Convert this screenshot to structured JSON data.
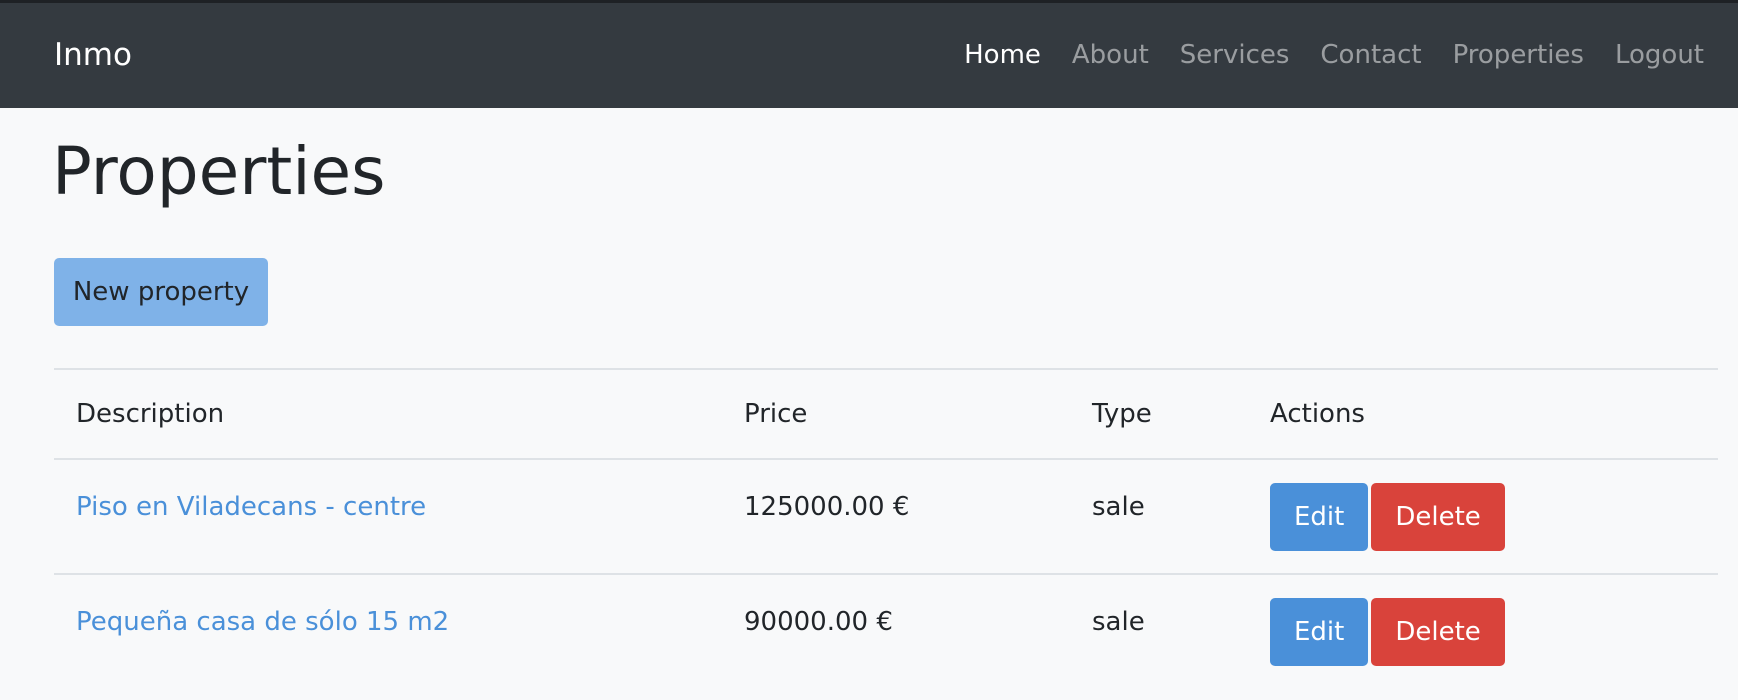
{
  "navbar": {
    "brand": "Inmo",
    "links": [
      {
        "label": "Home",
        "active": true
      },
      {
        "label": "About",
        "active": false
      },
      {
        "label": "Services",
        "active": false
      },
      {
        "label": "Contact",
        "active": false
      },
      {
        "label": "Properties",
        "active": false
      },
      {
        "label": "Logout",
        "active": false
      }
    ]
  },
  "page": {
    "title": "Properties",
    "new_button_label": "New property"
  },
  "table": {
    "headers": [
      "Description",
      "Price",
      "Type",
      "Actions"
    ],
    "rows": [
      {
        "description": "Piso en Viladecans - centre",
        "price": "125000.00 €",
        "type": "sale",
        "edit_label": "Edit",
        "delete_label": "Delete"
      },
      {
        "description": "Pequeña casa de sólo 15 m2",
        "price": "90000.00 €",
        "type": "sale",
        "edit_label": "Edit",
        "delete_label": "Delete"
      }
    ]
  },
  "colors": {
    "navbar_bg": "#343a40",
    "primary": "#4a90d9",
    "primary_light": "#7fb2e8",
    "danger": "#d9433b",
    "page_bg": "#f8f9fa"
  }
}
